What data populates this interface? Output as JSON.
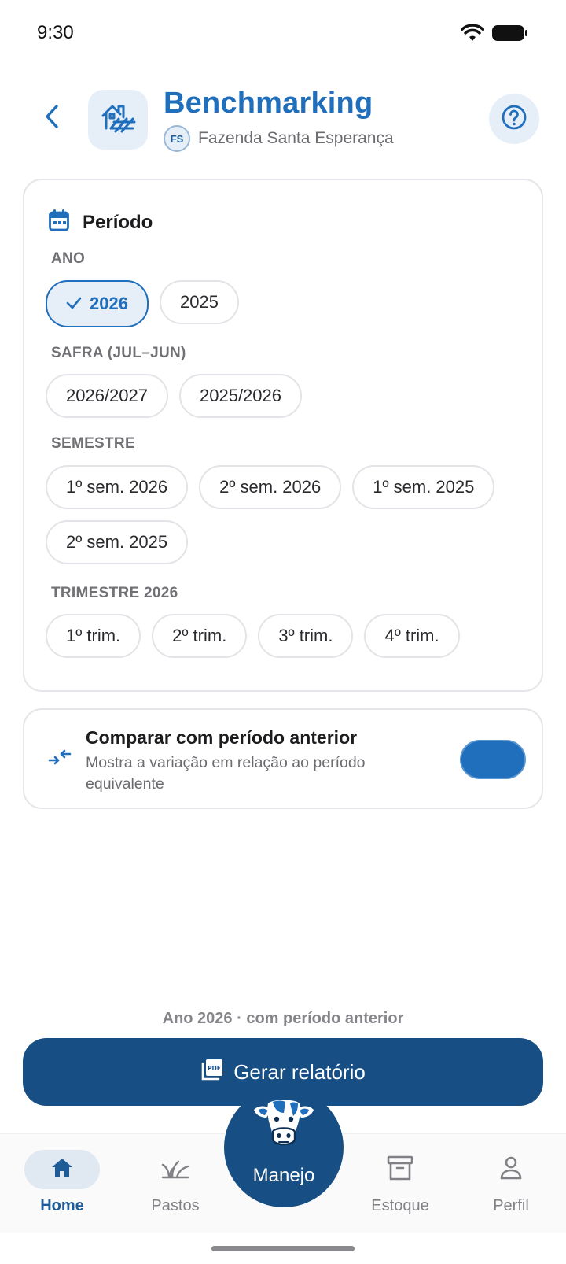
{
  "status_bar": {
    "time": "9:30",
    "icons": [
      "wifi-icon",
      "battery-icon"
    ]
  },
  "header": {
    "title": "Benchmarking",
    "farm_initials": "FS",
    "farm_name": "Fazenda Santa Esperança",
    "icons": [
      "chevron-left-icon",
      "farm-icon",
      "help-icon"
    ]
  },
  "period": {
    "title": "Período",
    "year": {
      "label": "ANO",
      "options": [
        "2026",
        "2025"
      ],
      "selected": "2026"
    },
    "crop": {
      "label": "SAFRA (JUL–JUN)",
      "options": [
        "2026/2027",
        "2025/2026"
      ]
    },
    "semester": {
      "label": "SEMESTRE",
      "options": [
        "1º sem. 2026",
        "2º sem. 2026",
        "1º sem. 2025",
        "2º sem. 2025"
      ]
    },
    "quarter": {
      "label": "TRIMESTRE 2026",
      "options": [
        "1º trim.",
        "2º trim.",
        "3º trim.",
        "4º trim."
      ]
    }
  },
  "compare": {
    "title": "Comparar com período anterior",
    "description": "Mostra a variação em relação ao período equivalente",
    "enabled": true
  },
  "summary": "Ano 2026 · com período anterior",
  "cta": {
    "label": "Gerar relatório",
    "icon": "pdf-icon"
  },
  "nav": {
    "items": [
      {
        "label": "Home",
        "icon": "home-icon",
        "active": true
      },
      {
        "label": "Pastos",
        "icon": "grass-icon",
        "active": false
      },
      {
        "label": "Estoque",
        "icon": "archive-icon",
        "active": false
      },
      {
        "label": "Perfil",
        "icon": "person-icon",
        "active": false
      }
    ],
    "fab_label": "Manejo"
  },
  "colors": {
    "primary": "#1f6fbd",
    "primary_dark": "#174f84",
    "tint": "#e6eff8",
    "muted": "#707075"
  }
}
